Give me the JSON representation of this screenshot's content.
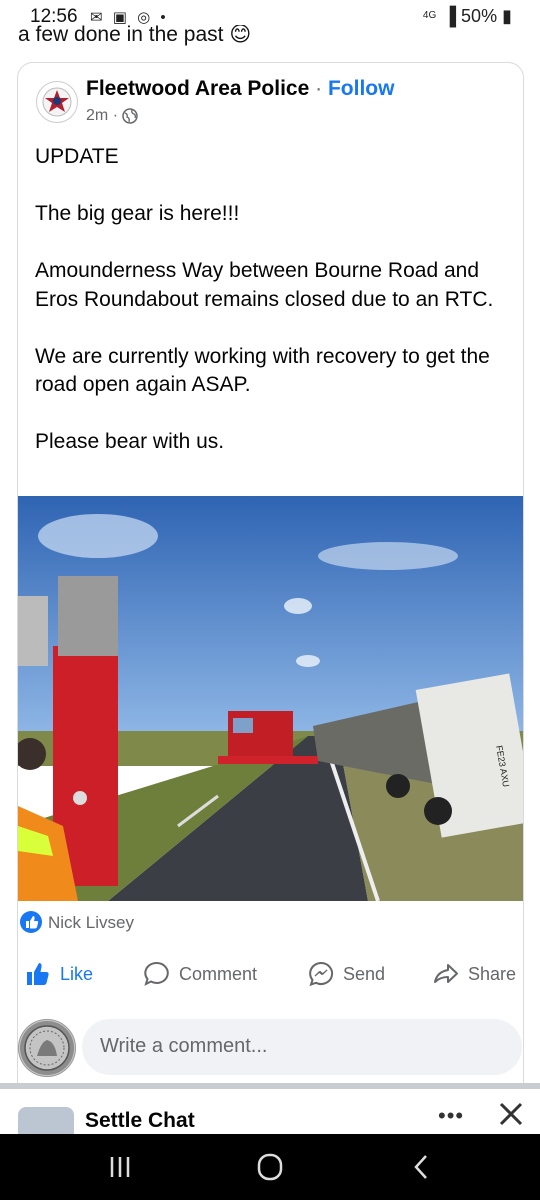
{
  "status_bar": {
    "time": "12:56",
    "network": "4G",
    "battery": "50%",
    "left_icons": [
      "notification-icon",
      "gallery-icon",
      "messenger-icon",
      "dot-icon"
    ]
  },
  "previous_post": {
    "text": "a few done in the past"
  },
  "post": {
    "page_name": "Fleetwood Area Police",
    "separator": "·",
    "follow_label": "Follow",
    "time": "2m",
    "meta_separator": "·",
    "paragraphs": [
      "UPDATE",
      "The big gear is here!!!",
      "Amounderness Way between Bourne Road and Eros Roundabout remains closed due to an RTC.",
      "We are currently working with recovery to get the road open again ASAP.",
      "Please bear with us."
    ],
    "photo_plate": "FE23 AXU",
    "reactor": "Nick Livsey",
    "actions": {
      "like": "Like",
      "comment": "Comment",
      "send": "Send",
      "share": "Share"
    }
  },
  "comment_composer": {
    "placeholder": "Write a comment..."
  },
  "next_post": {
    "title": "Settle Chat"
  },
  "colors": {
    "facebook_blue": "#1877f2",
    "secondary_text": "#65676b",
    "composer_bg": "#f0f2f5"
  }
}
